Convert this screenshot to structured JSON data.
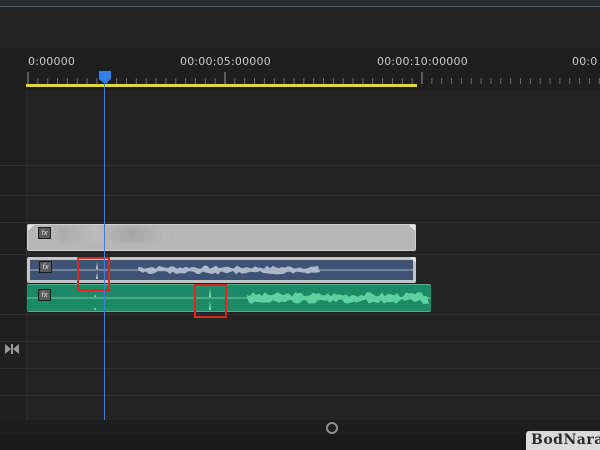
{
  "timeline": {
    "timecodes": [
      "0:00000",
      "00:00:05:00000",
      "00:00:10:00000",
      "00:0"
    ],
    "playhead_position": "0:00000",
    "colors": {
      "background": "#232323",
      "work_area_bar": "#e6d53c",
      "playhead": "#3d7fd9",
      "video_clip": "#b7b7b7",
      "audio_clip_1": "#3d5274",
      "audio_clip_2": "#1c8a66",
      "highlight": "#e02424"
    }
  },
  "clips": {
    "video": {
      "fx_label": "fx"
    },
    "audio1": {
      "fx_label": "fx"
    },
    "audio2": {
      "fx_label": "fx"
    }
  },
  "icons": {
    "playhead": "playhead-handle-icon",
    "snap": "ripple-trim-icon",
    "scroll": "zoom-scroll-handle-icon"
  },
  "watermark": {
    "text": "BodNara"
  }
}
